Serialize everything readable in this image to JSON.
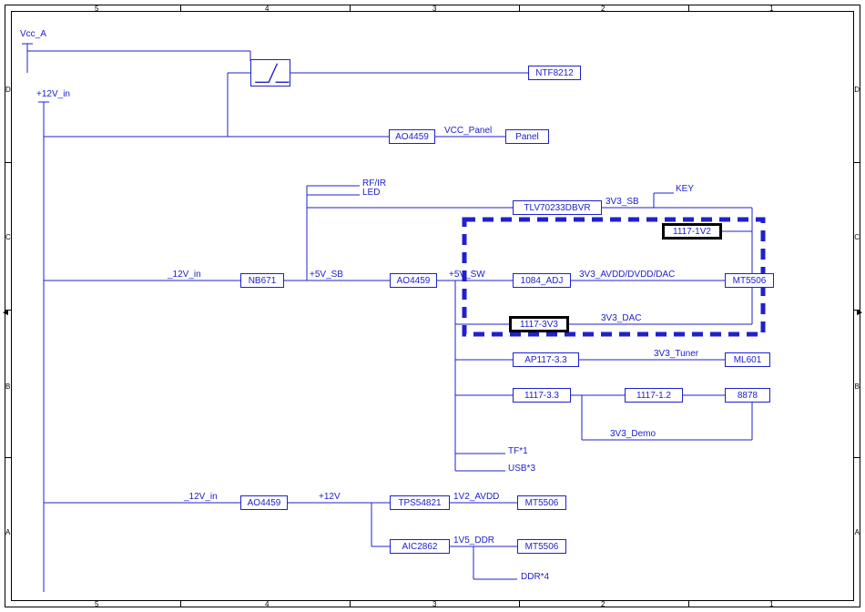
{
  "frame": {
    "cols_top": [
      "5",
      "4",
      "3",
      "2",
      "1"
    ],
    "rows_left": [
      "D",
      "C",
      "B",
      "A"
    ]
  },
  "ports": {
    "vcc_a": "Vcc_A",
    "p12v_in": "+12V_in"
  },
  "labels": {
    "vcc_panel": "VCC_Panel",
    "rf_ir": "RF/IR",
    "led": "LED",
    "key": "KEY",
    "sb_3v3": "3V3_SB",
    "net_12v_in_a": "_12V_in",
    "net_12v_in_b": "_12V_in",
    "p5v_sb": "+5V_SB",
    "p5v_sw": "+5V_SW",
    "avdd_dvdd_dac": "3V3_AVDD/DVDD/DAC",
    "dac_3v3": "3V3_DAC",
    "tuner_3v3": "3V3_Tuner",
    "demo_3v3": "3V3_Demo",
    "tf1": "TF*1",
    "usb3": "USB*3",
    "p12v": "+12V",
    "avdd_1v2": "1V2_AVDD",
    "ddr_1v5": "1V5_DDR",
    "ddr4": "DDR*4"
  },
  "blocks": {
    "ntf8212": "NTF8212",
    "ao4459_a": "AO4459",
    "panel": "Panel",
    "nb671": "NB671",
    "ao4459_b": "AO4459",
    "ao4459_c": "AO4459",
    "tlv": "TLV70233DBVR",
    "adj_1084": "1084_ADJ",
    "ic_1117_1v2": "1117-1V2",
    "ic_1117_3v3": "1117-3V3",
    "mt5506_a": "MT5506",
    "ap117": "AP117-3.3",
    "ml601": "ML601",
    "ic_1117_33": "1117-3.3",
    "ic_1117_12": "1117-1.2",
    "ic_8878": "8878",
    "tps54821": "TPS54821",
    "mt5506_b": "MT5506",
    "aic2862": "AIC2862",
    "mt5506_c": "MT5506"
  }
}
